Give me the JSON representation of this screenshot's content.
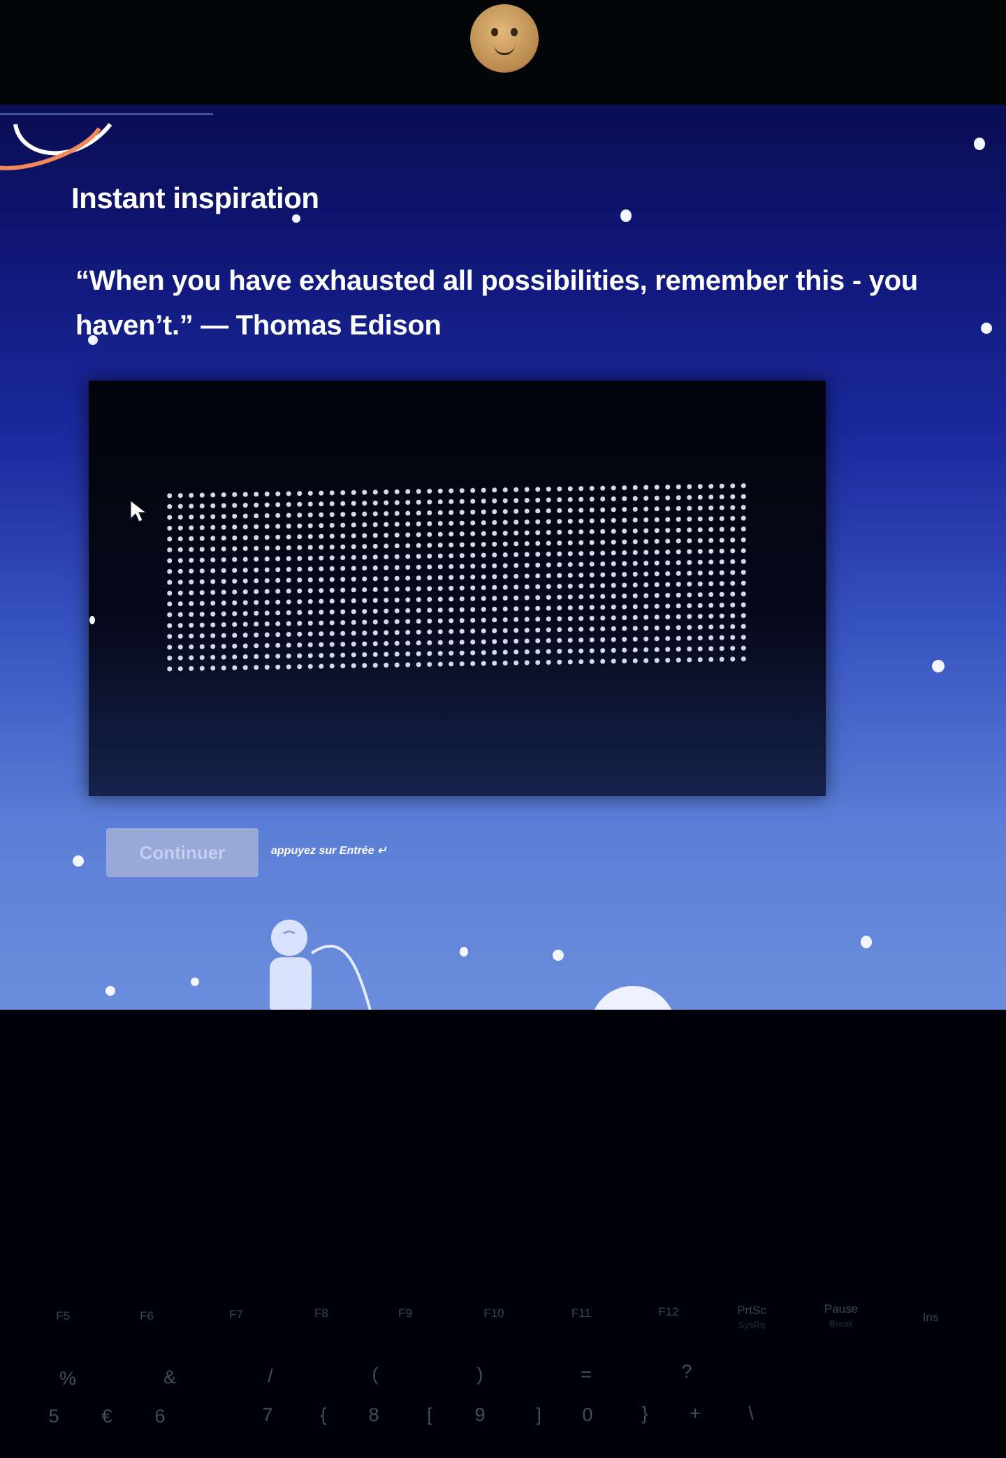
{
  "page": {
    "heading": "Instant inspiration",
    "quote": "“When you have exhausted all possibilities, remember this - you haven’t.” — Thomas Edison"
  },
  "actions": {
    "continue_label": "Continuer",
    "hint": "appuyez sur Entrée ↵"
  },
  "keyboard": {
    "function_keys": [
      {
        "label": "F5"
      },
      {
        "label": "F6"
      },
      {
        "label": "F7"
      },
      {
        "label": "F8"
      },
      {
        "label": "F9"
      },
      {
        "label": "F10"
      },
      {
        "label": "F11"
      },
      {
        "label": "F12"
      },
      {
        "label": "PrtSc",
        "sub": "SysRq"
      },
      {
        "label": "Pause",
        "sub": "Break"
      },
      {
        "label": "Ins"
      }
    ],
    "symbol_keys": [
      "%",
      "&",
      "/",
      "(",
      ")",
      "=",
      "?"
    ],
    "number_keys": [
      "5",
      "€",
      "6",
      "7",
      "{",
      "8",
      "[",
      "9",
      "]",
      "0",
      "}",
      "+",
      "\\"
    ]
  },
  "colors": {
    "screen_top": "#0a0d52",
    "screen_bottom": "#6b8ddc",
    "panel": "#02030c",
    "button_disabled": "#98a8d8"
  },
  "icons": [
    "logo-icon",
    "cursor-icon",
    "astronaut-icon",
    "planet-icon",
    "webcam-icon"
  ]
}
